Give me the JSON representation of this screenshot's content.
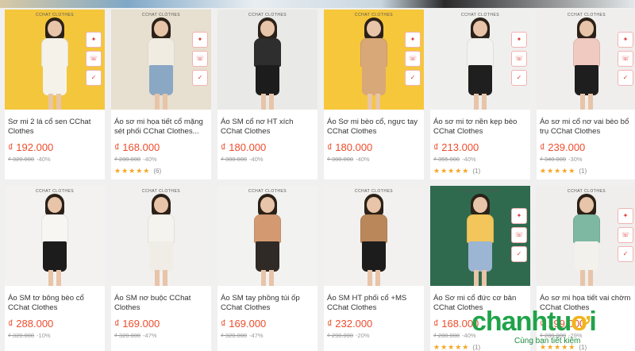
{
  "colors": {
    "price": "#ee4d2d",
    "star": "#f5a623",
    "brand_green": "#20a34a",
    "brand_orange": "#f0b41e"
  },
  "products": [
    {
      "name": "Sơ mi 2 lá cổ sen CChat Clothes",
      "price": "₫ 192.000",
      "old_price": "₫ 320.000",
      "discount": "-40%",
      "stars": "",
      "reviews": "",
      "has_badges": true,
      "bg": "#f4c63c",
      "top": "#f5f2ea",
      "bottom": "#f5f2ea"
    },
    {
      "name": "Áo sơ mi họa tiết cổ mặng sét phối CChat Clothes...",
      "price": "₫ 168.000",
      "old_price": "₫ 280.000",
      "discount": "-40%",
      "stars": "★★★★★",
      "reviews": "(6)",
      "has_badges": true,
      "bg": "#e7dfcf",
      "top": "#f1ece2",
      "bottom": "#8aa7c4"
    },
    {
      "name": "Áo SM cổ nơ HT xích CChat Clothes",
      "price": "₫ 180.000",
      "old_price": "₫ 300.000",
      "discount": "-40%",
      "stars": "",
      "reviews": "",
      "has_badges": false,
      "bg": "#e9e9e7",
      "top": "#2e2e2e",
      "bottom": "#1c1c1c"
    },
    {
      "name": "Áo Sơ mi bèo cổ, ngực tay CChat Clothes",
      "price": "₫ 180.000",
      "old_price": "₫ 300.000",
      "discount": "-40%",
      "stars": "",
      "reviews": "",
      "has_badges": true,
      "bg": "#f6c73a",
      "top": "#d9a878",
      "bottom": "#d9a878"
    },
    {
      "name": "Áo sơ mi tơ nền kẹp bèo CChat Clothes",
      "price": "₫ 213.000",
      "old_price": "₫ 355.000",
      "discount": "-40%",
      "stars": "★★★★★",
      "reviews": "(1)",
      "has_badges": true,
      "bg": "#efefee",
      "top": "#f2f2f0",
      "bottom": "#1f1f1f"
    },
    {
      "name": "Áo sơ mi cổ nơ vai bèo bổ trụ CChat Clothes",
      "price": "₫ 239.000",
      "old_price": "₫ 340.000",
      "discount": "-30%",
      "stars": "★★★★★",
      "reviews": "(1)",
      "has_badges": true,
      "bg": "#f0eeec",
      "top": "#f0c9c0",
      "bottom": "#1e1e1e"
    },
    {
      "name": "Áo SM tơ bông bèo cổ CChat Clothes",
      "price": "₫ 288.000",
      "old_price": "₫ 320.000",
      "discount": "-10%",
      "stars": "",
      "reviews": "",
      "has_badges": false,
      "bg": "#f3f2f0",
      "top": "#f7f6f3",
      "bottom": "#1c1c1c"
    },
    {
      "name": "Áo SM nơ buộc CChat Clothes",
      "price": "₫ 169.000",
      "old_price": "₫ 320.000",
      "discount": "-47%",
      "stars": "",
      "reviews": "",
      "has_badges": false,
      "bg": "#f1f0ee",
      "top": "#f5f3ee",
      "bottom": "#f0ede6"
    },
    {
      "name": "Áo SM tay phồng túi ốp CChat Clothes",
      "price": "₫ 169.000",
      "old_price": "₫ 320.000",
      "discount": "-47%",
      "stars": "",
      "reviews": "",
      "has_badges": false,
      "bg": "#f2f2f1",
      "top": "#d39a72",
      "bottom": "#2f2a26"
    },
    {
      "name": "Áo SM HT phối cổ +MS CChat Clothes",
      "price": "₫ 232.000",
      "old_price": "₫ 290.000",
      "discount": "-20%",
      "stars": "",
      "reviews": "",
      "has_badges": false,
      "bg": "#f2f1ef",
      "top": "#b9875a",
      "bottom": "#1c1c1c"
    },
    {
      "name": "Áo Sơ mi cổ đức cơ bản CChat Clothes",
      "price": "₫ 168.000",
      "old_price": "₫ 280.000",
      "discount": "-40%",
      "stars": "★★★★★",
      "reviews": "(1)",
      "has_badges": true,
      "bg": "#2f6a4e",
      "top": "#f2c65a",
      "bottom": "#9cb5d3"
    },
    {
      "name": "Áo sơ mi họa tiết vai chờm CChat Clothes",
      "price": "₫ 199.000",
      "old_price": "₫ 280.000",
      "discount": "-29%",
      "stars": "★★★★★",
      "reviews": "(1)",
      "has_badges": true,
      "bg": "#efeeec",
      "top": "#7fb8a2",
      "bottom": "#f3f1ec"
    }
  ],
  "badge_labels": [
    "✦",
    "☏",
    "✓"
  ],
  "brand": {
    "name_a": "chanhtu",
    "name_o": "ơ",
    "name_b": "i",
    "slogan": "Cùng bạn tiết kiệm"
  },
  "shop_logo": "CCHAT CLOTHES"
}
